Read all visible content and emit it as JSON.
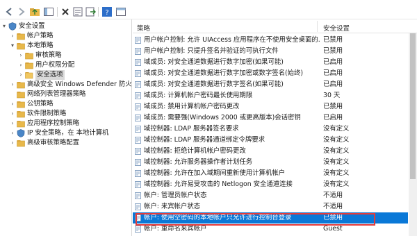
{
  "toolbar": {
    "icons": [
      "back-arrow-icon",
      "forward-arrow-icon",
      "up-folder-icon",
      "show-hide-tree-icon",
      "delete-icon",
      "properties-icon",
      "export-list-icon",
      "help-icon",
      "window-icon"
    ]
  },
  "tree": {
    "items": [
      {
        "label": "安全设置",
        "expand": "▾",
        "icon": "shield"
      },
      {
        "label": "帐户策略",
        "expand": "›",
        "icon": "folder"
      },
      {
        "label": "本地策略",
        "expand": "▾",
        "icon": "folder"
      },
      {
        "label": "审核策略",
        "expand": "›",
        "icon": "folder"
      },
      {
        "label": "用户权限分配",
        "expand": "›",
        "icon": "folder"
      },
      {
        "label": "安全选项",
        "expand": "›",
        "icon": "folder-open"
      },
      {
        "label": "高级安全 Windows Defender 防火墙",
        "expand": "›",
        "icon": "folder"
      },
      {
        "label": "网络列表管理器策略",
        "expand": "",
        "icon": "folder"
      },
      {
        "label": "公钥策略",
        "expand": "›",
        "icon": "folder"
      },
      {
        "label": "软件限制策略",
        "expand": "›",
        "icon": "folder"
      },
      {
        "label": "应用程序控制策略",
        "expand": "›",
        "icon": "folder"
      },
      {
        "label": "IP 安全策略，在 本地计算机",
        "expand": "›",
        "icon": "shield"
      },
      {
        "label": "高级审核策略配置",
        "expand": "›",
        "icon": "folder"
      }
    ]
  },
  "table": {
    "col_policy": "策略",
    "col_setting": "安全设置",
    "rows": [
      {
        "name": "用户帐户控制: 允许 UIAccess 应用程序在不使用安全桌面的...",
        "value": "已禁用"
      },
      {
        "name": "用户帐户控制: 只提升签名并验证的可执行文件",
        "value": "已禁用"
      },
      {
        "name": "域成员: 对安全通道数据进行数字加密(如果可能)",
        "value": "已启用"
      },
      {
        "name": "域成员: 对安全通道数据进行数字加密或数字签名(始终)",
        "value": "已启用"
      },
      {
        "name": "域成员: 对安全通道数据进行数字签名(如果可能)",
        "value": "已启用"
      },
      {
        "name": "域成员: 计算机帐户密码最长使用期限",
        "value": "30 天"
      },
      {
        "name": "域成员: 禁用计算机帐户密码更改",
        "value": "已禁用"
      },
      {
        "name": "域成员: 需要强(Windows 2000 或更高版本)会话密钥",
        "value": "已启用"
      },
      {
        "name": "域控制器: LDAP 服务器签名要求",
        "value": "没有定义"
      },
      {
        "name": "域控制器: LDAP 服务器通道绑定令牌要求",
        "value": "没有定义"
      },
      {
        "name": "域控制器: 拒绝计算机帐户密码更改",
        "value": "没有定义"
      },
      {
        "name": "域控制器: 允许服务器操作者计划任务",
        "value": "没有定义"
      },
      {
        "name": "域控制器:   允许在加入域期间重新使用计算机帐户",
        "value": "没有定义"
      },
      {
        "name": "域控制器: 允许易受攻击的 Netlogon 安全通道连接",
        "value": "没有定义"
      },
      {
        "name": "帐户: 管理员帐户状态",
        "value": "不适用"
      },
      {
        "name": "帐户: 来宾帐户状态",
        "value": "不适用"
      },
      {
        "name": "帐户: 使用空密码的本地帐户只允许进行控制台登录",
        "value": "已禁用"
      },
      {
        "name": "帐户: 重命名来宾帐户",
        "value": "Guest"
      }
    ]
  },
  "colors": {
    "selection": "#0a78d7",
    "highlight_box": "#e23b3b",
    "folder": "#e8b84a"
  }
}
